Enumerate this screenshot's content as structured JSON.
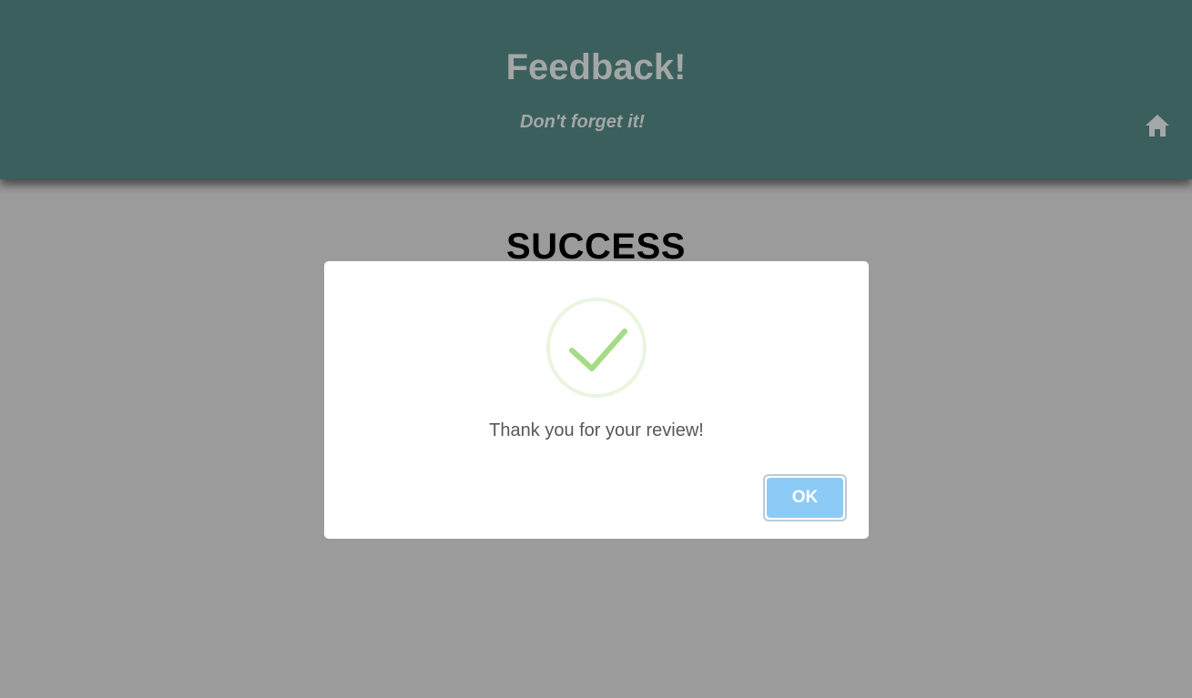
{
  "header": {
    "title": "Feedback!",
    "subtitle": "Don't forget it!",
    "home_icon": "home-icon"
  },
  "main": {
    "heading": "SUCCESS"
  },
  "modal": {
    "icon": "check-icon",
    "message": "Thank you for your review!",
    "ok_label": "OK"
  },
  "colors": {
    "header_bg": "#3b5f5d",
    "overlay_bg": "#9b9b9b",
    "success_green": "#a5dc86",
    "button_blue": "#8ccbf5"
  }
}
